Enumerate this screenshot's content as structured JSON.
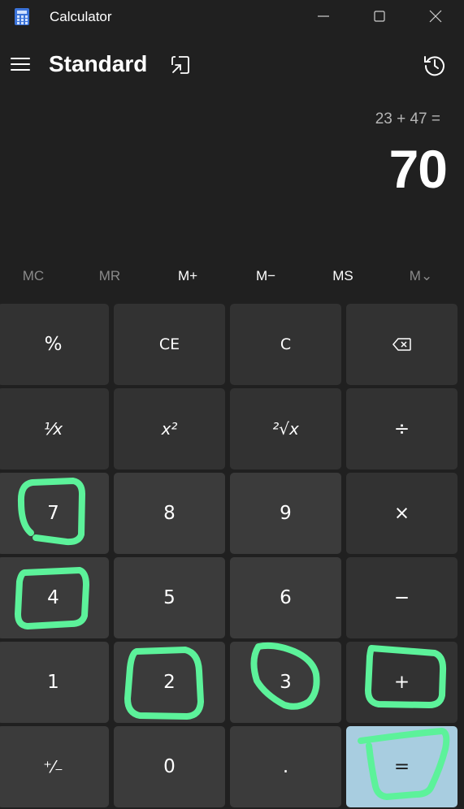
{
  "window": {
    "title": "Calculator",
    "controls": [
      "minimize-icon",
      "maximize-icon",
      "close-icon"
    ]
  },
  "header": {
    "mode": "Standard",
    "icons": [
      "hamburger-menu-icon",
      "keep-on-top-icon",
      "history-icon"
    ]
  },
  "display": {
    "expression": "23 + 47 =",
    "result": "70"
  },
  "memory": [
    {
      "label": "MC",
      "enabled": false
    },
    {
      "label": "MR",
      "enabled": false
    },
    {
      "label": "M+",
      "enabled": true
    },
    {
      "label": "M−",
      "enabled": true
    },
    {
      "label": "MS",
      "enabled": true
    },
    {
      "label": "M⌄",
      "enabled": false
    }
  ],
  "keys": [
    [
      "%",
      "CE",
      "C",
      "backspace-icon"
    ],
    [
      "¹⁄x",
      "x²",
      "²√x",
      "÷"
    ],
    [
      "7",
      "8",
      "9",
      "×"
    ],
    [
      "4",
      "5",
      "6",
      "−"
    ],
    [
      "1",
      "2",
      "3",
      "+"
    ],
    [
      "⁺⁄₋",
      "0",
      ".",
      "="
    ]
  ],
  "annotations": {
    "color": "#5cf29a",
    "circled_keys": [
      "7",
      "4",
      "2",
      "3",
      "+",
      "="
    ]
  },
  "colors": {
    "background": "#202020",
    "function_key": "#323232",
    "number_key": "#3b3b3b",
    "equals_key": "#a8cde0"
  }
}
